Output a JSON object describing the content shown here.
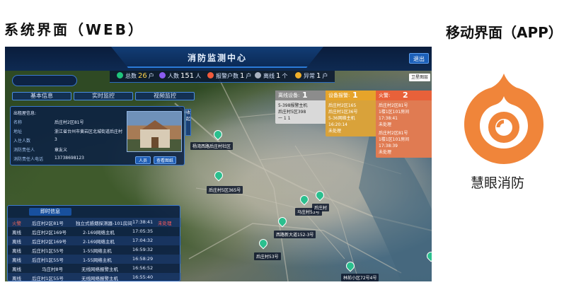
{
  "headings": {
    "web": "系统界面（WEB）",
    "app": "移动界面（APP）"
  },
  "web": {
    "title": "消防监测中心",
    "exit_label": "退出",
    "satellite_label": "卫星图层",
    "stats": [
      {
        "label": "总数",
        "value": "26",
        "unit": "户",
        "color": "#1fc47c"
      },
      {
        "label": "人数",
        "value": "151",
        "unit": "人",
        "color": "#8a5cf0"
      },
      {
        "label": "报警户数",
        "value": "1",
        "unit": "户",
        "color": "#f05a3c"
      },
      {
        "label": "离线",
        "value": "1",
        "unit": "个",
        "color": "#a8b2c0"
      },
      {
        "label": "异常",
        "value": "1",
        "unit": "户",
        "color": "#f0b02a"
      }
    ],
    "tabs": [
      "基本信息",
      "实时监控",
      "视频监控"
    ],
    "info_panel": {
      "heading": "出租屋信息:",
      "rows": [
        {
          "label": "名称",
          "value": "后庄村2区81号"
        },
        {
          "label": "地址",
          "value": "浙江省台州市黄岩区北城街道后庄村"
        },
        {
          "label": "入住人数",
          "value": "3"
        },
        {
          "label": "消防责任人",
          "value": "章友义"
        },
        {
          "label": "消防责任人电话",
          "value": "13738698123"
        }
      ],
      "buttons": [
        "人员",
        "查看图纸"
      ],
      "collapse_label": "收起"
    },
    "realtime": {
      "header": "即时信息",
      "rows": [
        {
          "status": "火警",
          "place": "后庄村2区81号",
          "device": "独立式感烟探测器-101房间",
          "time": "17:38:41",
          "state": "未处理"
        },
        {
          "status": "离线",
          "place": "后庄村2区169号",
          "device": "2-169网络主机",
          "time": "17:05:35",
          "state": ""
        },
        {
          "status": "离线",
          "place": "后庄村2区169号",
          "device": "2-169网络主机",
          "time": "17:04:32",
          "state": ""
        },
        {
          "status": "离线",
          "place": "后庄村1区55号",
          "device": "1-55网络主机",
          "time": "16:59:32",
          "state": ""
        },
        {
          "status": "离线",
          "place": "后庄村1区55号",
          "device": "1-55网络主机",
          "time": "16:58:29",
          "state": ""
        },
        {
          "status": "离线",
          "place": "马庄村8号",
          "device": "无线网络报警主机",
          "time": "16:56:52",
          "state": ""
        },
        {
          "status": "离线",
          "place": "后庄村1区55号",
          "device": "无线网络报警主机",
          "time": "16:55:40",
          "state": ""
        }
      ]
    },
    "alerts": [
      {
        "title": "离线设备:",
        "count": "1",
        "color": "#d9d9d9",
        "header_color": "#8c8c8c",
        "text_color": "#222222",
        "lines": [
          "5-398报警主机",
          "后庄村5区398",
          "一 1 1"
        ]
      },
      {
        "title": "设备报警:",
        "count": "1",
        "color": "#d9a23a",
        "header_color": "#e6a42a",
        "text_color": "#ffffff",
        "lines": [
          "后庄村2区165",
          "后庄村1区36号",
          "5-36网络主机",
          "16:20:14",
          "未处理"
        ]
      },
      {
        "title": "火警:",
        "count": "2",
        "color": "#e07b52",
        "header_color": "#e8613a",
        "text_color": "#ffffff",
        "lines": [
          "后庄村2区81号",
          "1楼1区101房间",
          "17:38:41",
          "未处理",
          "后庄村2区81号",
          "1楼1区101房间",
          "17:38:39",
          "未处理"
        ]
      }
    ],
    "map_labels": [
      "后庄村2区81号",
      "杨湾西路后庄村社区",
      "后庄村5区365号",
      "马庄村53号",
      "后庄村",
      "西路新大道152-3号",
      "后庄村53号",
      "林前小区72号4号"
    ]
  },
  "app": {
    "name": "慧眼消防",
    "brand_color": "#f0853a"
  }
}
